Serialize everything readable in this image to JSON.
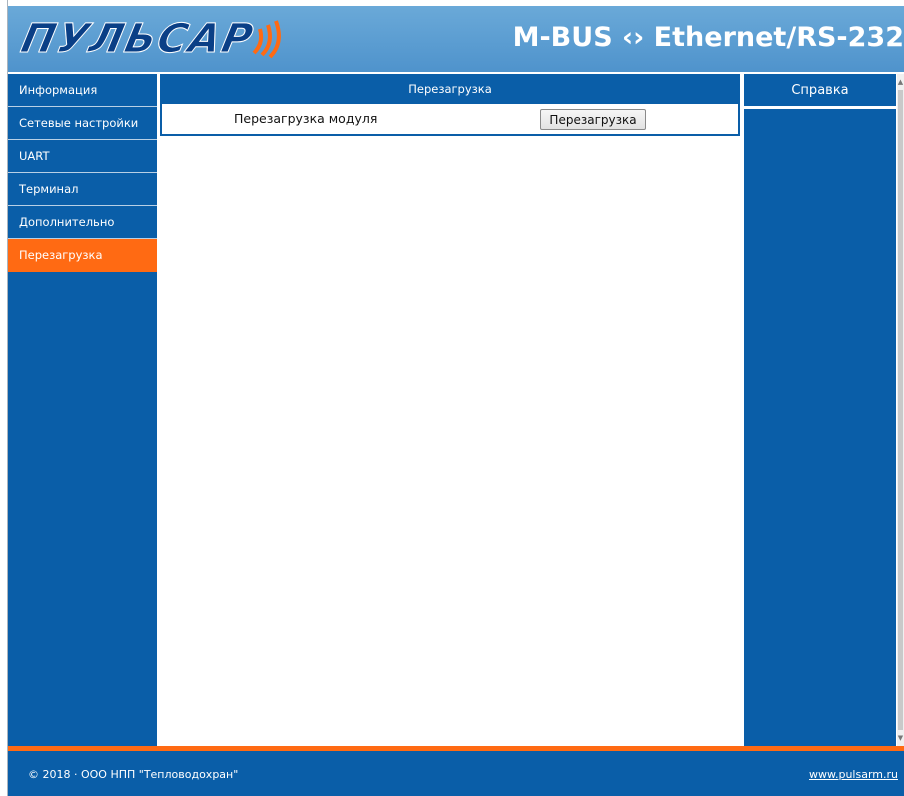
{
  "header": {
    "logo_text": "ПУЛЬСАР",
    "title": "M-BUS ‹› Ethernet/RS-232"
  },
  "sidebar": {
    "items": [
      {
        "label": "Информация"
      },
      {
        "label": "Сетевые настройки"
      },
      {
        "label": "UART"
      },
      {
        "label": "Терминал"
      },
      {
        "label": "Дополнительно"
      },
      {
        "label": "Перезагрузка"
      }
    ],
    "active_index": 5
  },
  "main": {
    "panel_title": "Перезагрузка",
    "row_label": "Перезагрузка модуля",
    "button_label": "Перезагрузка"
  },
  "help": {
    "title": "Справка"
  },
  "footer": {
    "copyright": "© 2018 · ООО НПП \"Тепловодохран\"",
    "link": "www.pulsarm.ru"
  },
  "colors": {
    "brand_blue": "#0a5ea8",
    "header_blue": "#5a9bd0",
    "accent_orange": "#ff6a13"
  }
}
